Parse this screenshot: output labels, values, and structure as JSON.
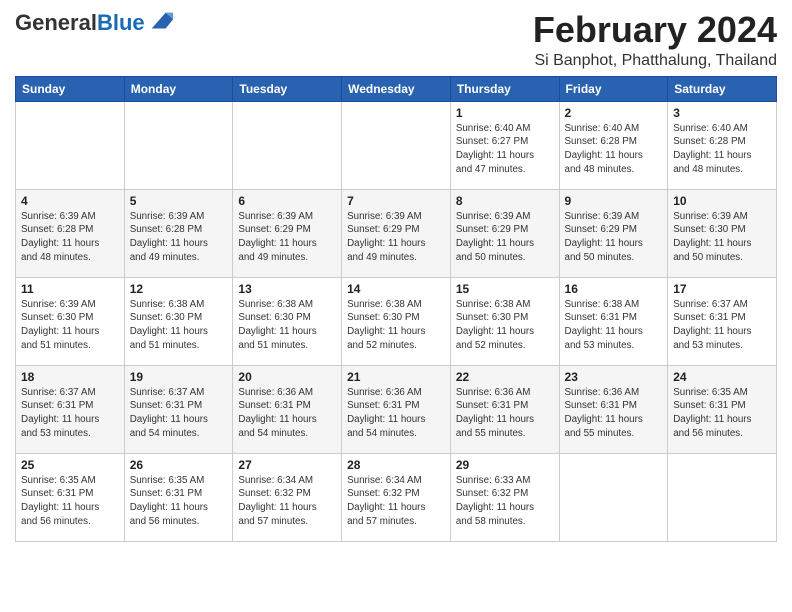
{
  "header": {
    "logo_general": "General",
    "logo_blue": "Blue",
    "month_title": "February 2024",
    "location": "Si Banphot, Phatthalung, Thailand"
  },
  "weekdays": [
    "Sunday",
    "Monday",
    "Tuesday",
    "Wednesday",
    "Thursday",
    "Friday",
    "Saturday"
  ],
  "weeks": [
    [
      {
        "day": "",
        "info": ""
      },
      {
        "day": "",
        "info": ""
      },
      {
        "day": "",
        "info": ""
      },
      {
        "day": "",
        "info": ""
      },
      {
        "day": "1",
        "info": "Sunrise: 6:40 AM\nSunset: 6:27 PM\nDaylight: 11 hours\nand 47 minutes."
      },
      {
        "day": "2",
        "info": "Sunrise: 6:40 AM\nSunset: 6:28 PM\nDaylight: 11 hours\nand 48 minutes."
      },
      {
        "day": "3",
        "info": "Sunrise: 6:40 AM\nSunset: 6:28 PM\nDaylight: 11 hours\nand 48 minutes."
      }
    ],
    [
      {
        "day": "4",
        "info": "Sunrise: 6:39 AM\nSunset: 6:28 PM\nDaylight: 11 hours\nand 48 minutes."
      },
      {
        "day": "5",
        "info": "Sunrise: 6:39 AM\nSunset: 6:28 PM\nDaylight: 11 hours\nand 49 minutes."
      },
      {
        "day": "6",
        "info": "Sunrise: 6:39 AM\nSunset: 6:29 PM\nDaylight: 11 hours\nand 49 minutes."
      },
      {
        "day": "7",
        "info": "Sunrise: 6:39 AM\nSunset: 6:29 PM\nDaylight: 11 hours\nand 49 minutes."
      },
      {
        "day": "8",
        "info": "Sunrise: 6:39 AM\nSunset: 6:29 PM\nDaylight: 11 hours\nand 50 minutes."
      },
      {
        "day": "9",
        "info": "Sunrise: 6:39 AM\nSunset: 6:29 PM\nDaylight: 11 hours\nand 50 minutes."
      },
      {
        "day": "10",
        "info": "Sunrise: 6:39 AM\nSunset: 6:30 PM\nDaylight: 11 hours\nand 50 minutes."
      }
    ],
    [
      {
        "day": "11",
        "info": "Sunrise: 6:39 AM\nSunset: 6:30 PM\nDaylight: 11 hours\nand 51 minutes."
      },
      {
        "day": "12",
        "info": "Sunrise: 6:38 AM\nSunset: 6:30 PM\nDaylight: 11 hours\nand 51 minutes."
      },
      {
        "day": "13",
        "info": "Sunrise: 6:38 AM\nSunset: 6:30 PM\nDaylight: 11 hours\nand 51 minutes."
      },
      {
        "day": "14",
        "info": "Sunrise: 6:38 AM\nSunset: 6:30 PM\nDaylight: 11 hours\nand 52 minutes."
      },
      {
        "day": "15",
        "info": "Sunrise: 6:38 AM\nSunset: 6:30 PM\nDaylight: 11 hours\nand 52 minutes."
      },
      {
        "day": "16",
        "info": "Sunrise: 6:38 AM\nSunset: 6:31 PM\nDaylight: 11 hours\nand 53 minutes."
      },
      {
        "day": "17",
        "info": "Sunrise: 6:37 AM\nSunset: 6:31 PM\nDaylight: 11 hours\nand 53 minutes."
      }
    ],
    [
      {
        "day": "18",
        "info": "Sunrise: 6:37 AM\nSunset: 6:31 PM\nDaylight: 11 hours\nand 53 minutes."
      },
      {
        "day": "19",
        "info": "Sunrise: 6:37 AM\nSunset: 6:31 PM\nDaylight: 11 hours\nand 54 minutes."
      },
      {
        "day": "20",
        "info": "Sunrise: 6:36 AM\nSunset: 6:31 PM\nDaylight: 11 hours\nand 54 minutes."
      },
      {
        "day": "21",
        "info": "Sunrise: 6:36 AM\nSunset: 6:31 PM\nDaylight: 11 hours\nand 54 minutes."
      },
      {
        "day": "22",
        "info": "Sunrise: 6:36 AM\nSunset: 6:31 PM\nDaylight: 11 hours\nand 55 minutes."
      },
      {
        "day": "23",
        "info": "Sunrise: 6:36 AM\nSunset: 6:31 PM\nDaylight: 11 hours\nand 55 minutes."
      },
      {
        "day": "24",
        "info": "Sunrise: 6:35 AM\nSunset: 6:31 PM\nDaylight: 11 hours\nand 56 minutes."
      }
    ],
    [
      {
        "day": "25",
        "info": "Sunrise: 6:35 AM\nSunset: 6:31 PM\nDaylight: 11 hours\nand 56 minutes."
      },
      {
        "day": "26",
        "info": "Sunrise: 6:35 AM\nSunset: 6:31 PM\nDaylight: 11 hours\nand 56 minutes."
      },
      {
        "day": "27",
        "info": "Sunrise: 6:34 AM\nSunset: 6:32 PM\nDaylight: 11 hours\nand 57 minutes."
      },
      {
        "day": "28",
        "info": "Sunrise: 6:34 AM\nSunset: 6:32 PM\nDaylight: 11 hours\nand 57 minutes."
      },
      {
        "day": "29",
        "info": "Sunrise: 6:33 AM\nSunset: 6:32 PM\nDaylight: 11 hours\nand 58 minutes."
      },
      {
        "day": "",
        "info": ""
      },
      {
        "day": "",
        "info": ""
      }
    ]
  ]
}
